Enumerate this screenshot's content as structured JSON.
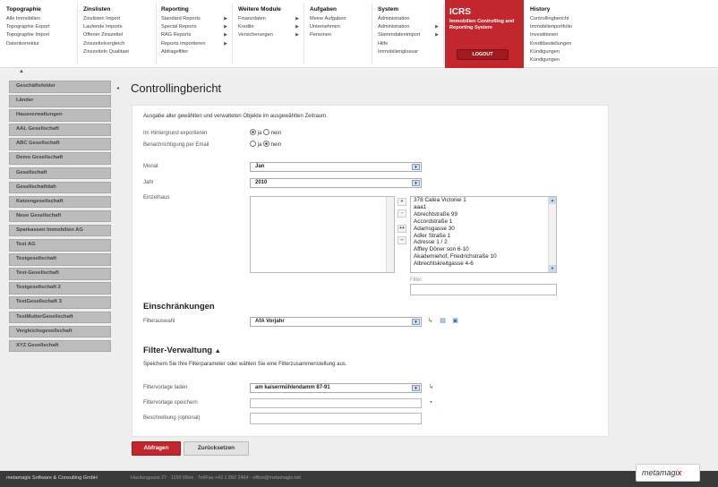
{
  "menu": [
    {
      "title": "Topographie",
      "items": [
        {
          "label": "Alle Immobilien"
        },
        {
          "label": "Topographie Export"
        },
        {
          "label": "Topographie Import"
        },
        {
          "label": "Datenkorrektur"
        }
      ]
    },
    {
      "title": "Zinslisten",
      "items": [
        {
          "label": "Zinslisten Import"
        },
        {
          "label": "Laufende Imports"
        },
        {
          "label": "Offener Zinszettel"
        },
        {
          "label": "Zinszettelvergleich"
        },
        {
          "label": "Zinszetteln Qualitaet"
        }
      ]
    },
    {
      "title": "Reporting",
      "items": [
        {
          "label": "Standard Reports"
        },
        {
          "label": "Special Reports"
        },
        {
          "label": "RAG Reports"
        },
        {
          "label": "Reports Importieren"
        },
        {
          "label": "Abfragefilter"
        }
      ]
    },
    {
      "title": "Weitere Module",
      "items": [
        {
          "label": "Finanzdaten"
        },
        {
          "label": "Kredite"
        },
        {
          "label": "Versicherungen"
        }
      ]
    },
    {
      "title": "Aufgaben",
      "items": [
        {
          "label": "Meine Aufgaben"
        },
        {
          "label": "Unternehmen"
        },
        {
          "label": "Personen"
        }
      ]
    },
    {
      "title": "System",
      "items": [
        {
          "label": "Administration"
        },
        {
          "label": "Administration"
        },
        {
          "label": "Stammdatenimport"
        },
        {
          "label": "Hilfe"
        },
        {
          "label": "Immobilienglossar"
        }
      ]
    },
    {
      "title": "History",
      "items": [
        {
          "label": "Controllingbericht"
        },
        {
          "label": "Immobilienportfolio"
        },
        {
          "label": "Investitionen"
        },
        {
          "label": "Kreditbestellungen"
        },
        {
          "label": "Kündigungen"
        },
        {
          "label": "Kündigungen"
        }
      ]
    }
  ],
  "brand": {
    "title": "ICRS",
    "subtitle": "Immobilien Controlling and Reporting System",
    "logout": "LOGOUT",
    "color": "#c1272d"
  },
  "sidebar": [
    "Geschäftsfelder",
    "Länder",
    "Hausverwaltungen",
    "AAL Gesellschaft",
    "ABC Gesellschaft",
    "Demo Gesellschaft",
    "Gesellschaft",
    "Gesellschaftdah",
    "Katzengesellschaft",
    "Neue Gesellschaft",
    "Sparkassen Immobilien AG",
    "Test AG",
    "Testgesellschaft",
    "Test-Gesellschaft",
    "Testgesellschaft 2",
    "TestGesellschaft 3",
    "TestMutterGesellschaft",
    "Vergleichsgesellschaft",
    "XYZ Gesellschaft"
  ],
  "page": {
    "title": "Controllingbericht"
  },
  "form": {
    "intro": "Ausgabe aller gewählten und verwalteten Objekte im ausgewählten Zeitraum.",
    "background_label": "Im Hintergrund exportieren",
    "notify_label": "Benachrichtigung per Email",
    "yes": "ja",
    "no": "nein",
    "month_label": "Monat",
    "month_value": "Jan",
    "year_label": "Jahr",
    "year_value": "2010",
    "houses_label": "Einzelhaus",
    "houses_options": [
      "378 Calea Victoriei 1",
      "aaa1",
      "Abrechtstraße 99",
      "Accordstraße 1",
      "Adamsgasse 30",
      "Adler Straße 1",
      "Adresse 1 / 2",
      "Affley Döner son 6-10",
      "Akademiehof, Friedrichstraße 10",
      "Albrechtskreitgasse 4-6"
    ],
    "filter_label": "Filter",
    "restrictions_title": "Einschränkungen",
    "filter_select_label": "Filterauswahl",
    "filter_select_value": "AfA Vorjahr",
    "filter_mgmt_title": "Filter-Verwaltung",
    "filter_mgmt_desc": "Speichern Sie Ihre Filterparameter oder wählen Sie eine Filterzusammenstellung aus.",
    "load_label": "Filtervorlage laden",
    "load_value": "am kaisermühlendamm 87-91",
    "save_label": "Filtervorlage speichern",
    "desc_label": "Beschreibung (optional)",
    "submit": "Abfragen",
    "reset": "Zurücksetzen"
  },
  "footer": {
    "company": "metamagix Software & Consulting GmbH",
    "address": "Hackengasse 27 · 1150 Wien · Tel/Fax +43 1 892 2464 · office@metamagix.net",
    "logo": "metamagi",
    "logo_x": "x"
  }
}
